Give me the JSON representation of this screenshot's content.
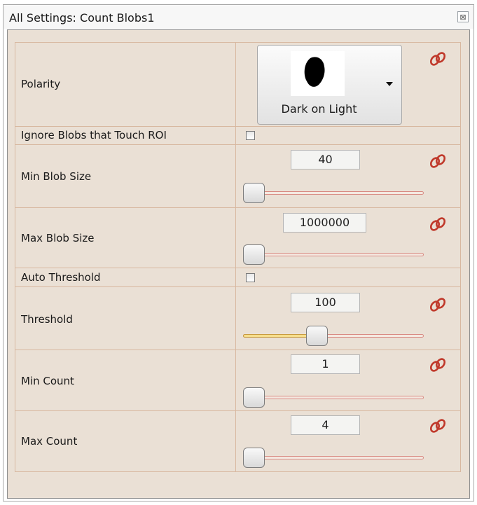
{
  "window": {
    "title": "All Settings: Count Blobs1",
    "close_symbol": "⊠"
  },
  "settings": [
    {
      "label": "Polarity",
      "type": "dropdown",
      "value": "Dark on Light",
      "preview_icon": "dark-blob-icon",
      "linkable": true
    },
    {
      "label": "Ignore Blobs that Touch ROI",
      "type": "checkbox",
      "checked": false
    },
    {
      "label": "Min Blob Size",
      "type": "slider",
      "value": "40",
      "slider_fraction": 0.0,
      "linkable": true
    },
    {
      "label": "Max Blob Size",
      "type": "slider",
      "value": "1000000",
      "slider_fraction": 0.0,
      "linkable": true
    },
    {
      "label": "Auto Threshold",
      "type": "checkbox",
      "checked": false
    },
    {
      "label": "Threshold",
      "type": "slider",
      "value": "100",
      "slider_fraction": 0.39,
      "linkable": true
    },
    {
      "label": "Min Count",
      "type": "slider",
      "value": "1",
      "slider_fraction": 0.0,
      "linkable": true
    },
    {
      "label": "Max Count",
      "type": "slider",
      "value": "4",
      "slider_fraction": 0.0,
      "linkable": true
    }
  ],
  "colors": {
    "panel": "#eae0d5",
    "grid_line": "#d8b8a0",
    "link_icon": "#c0392b",
    "slider_fill": "#f7de8c"
  }
}
